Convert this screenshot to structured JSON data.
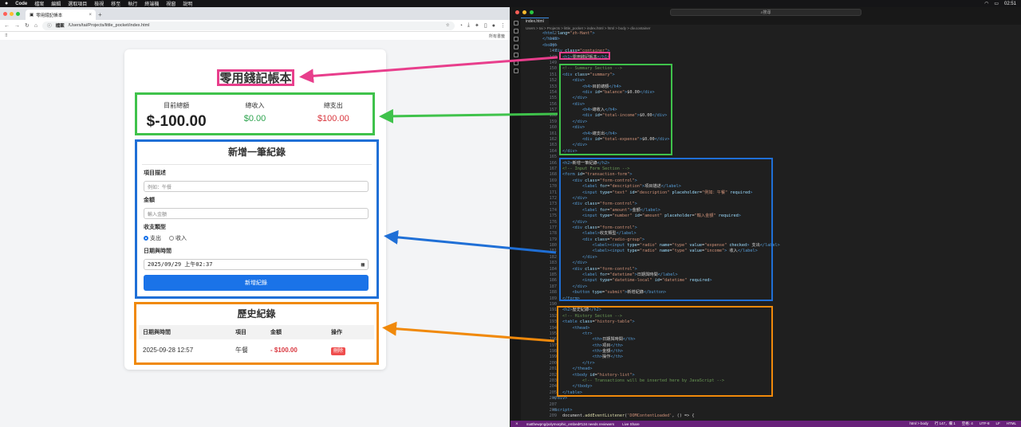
{
  "menubar": {
    "app": "Code",
    "items": [
      "檔案",
      "編輯",
      "選取項目",
      "檢視",
      "移至",
      "執行",
      "終端機",
      "視窗",
      "說明"
    ],
    "time": "02:51"
  },
  "browser": {
    "tab_title": "零用錢記帳本",
    "url_label": "檔案",
    "url": "/Users/tai/Projects/little_pocket/index.html",
    "all_bookmarks": "所有書籤"
  },
  "app": {
    "title": "零用錢記帳本",
    "summary": {
      "balance_label": "目前總額",
      "balance_value": "$-100.00",
      "income_label": "總收入",
      "income_value": "$0.00",
      "expense_label": "總支出",
      "expense_value": "$100.00"
    },
    "form": {
      "title": "新增一筆紀錄",
      "desc_label": "項目描述",
      "desc_placeholder": "例如：午餐",
      "amount_label": "金額",
      "amount_placeholder": "輸入金額",
      "type_label": "收支類型",
      "expense_option": "支出",
      "income_option": "收入",
      "datetime_label": "日期與時間",
      "datetime_value": "2025/09/29 上午02:37",
      "submit": "新增紀錄"
    },
    "history": {
      "title": "歷史紀錄",
      "headers": [
        "日期與時間",
        "項目",
        "金額",
        "操作"
      ],
      "rows": [
        {
          "date": "2025-09-28 12:57",
          "item": "午餐",
          "amount": "- $100.00",
          "action": "刪除"
        }
      ]
    }
  },
  "editor": {
    "search": "搜尋",
    "tab": "index.html",
    "breadcrumb": "Users > tai > Projects > little_pocket > index.html > html > body > div.container",
    "status_left": "matthewpng/polymorphic_embed#134 needs reviewers",
    "status_live": "Live Share",
    "status_right": [
      "html > body",
      "行 147，欄 1",
      "空格: 4",
      "UTF-8",
      "LF",
      "HTML"
    ],
    "colors": {
      "pink": "#e83e8c",
      "green": "#3fc24b",
      "blue": "#1f6fd6",
      "orange": "#f0890b"
    }
  }
}
